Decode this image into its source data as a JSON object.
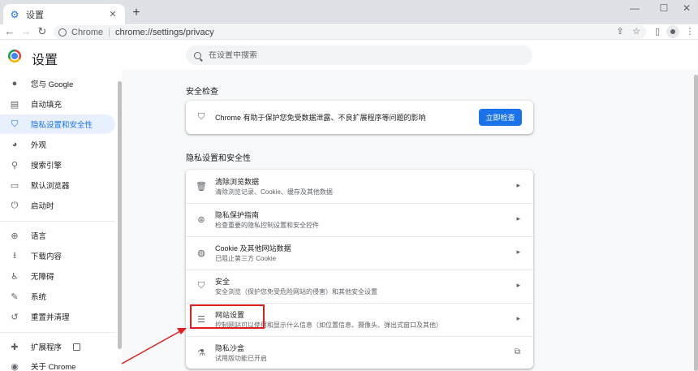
{
  "tab": {
    "title": "设置"
  },
  "address": {
    "site": "Chrome",
    "url": "chrome://settings/privacy"
  },
  "header": {
    "title": "设置",
    "search_placeholder": "在设置中搜索"
  },
  "sidebar": {
    "items": [
      {
        "label": "您与 Google",
        "icon": "person-icon"
      },
      {
        "label": "自动填充",
        "icon": "clipboard-icon"
      },
      {
        "label": "隐私设置和安全性",
        "icon": "shield-icon",
        "active": true
      },
      {
        "label": "外观",
        "icon": "palette-icon"
      },
      {
        "label": "搜索引擎",
        "icon": "search-icon"
      },
      {
        "label": "默认浏览器",
        "icon": "browser-icon"
      },
      {
        "label": "启动时",
        "icon": "power-icon"
      },
      {
        "label": "语言",
        "icon": "globe-icon"
      },
      {
        "label": "下载内容",
        "icon": "download-icon"
      },
      {
        "label": "无障碍",
        "icon": "accessibility-icon"
      },
      {
        "label": "系统",
        "icon": "wrench-icon"
      },
      {
        "label": "重置并清理",
        "icon": "reset-icon"
      },
      {
        "label": "扩展程序",
        "icon": "puzzle-icon"
      },
      {
        "label": "关于 Chrome",
        "icon": "chrome-icon"
      }
    ]
  },
  "safety_check": {
    "section_title": "安全检查",
    "description": "Chrome 有助于保护您免受数据泄露、不良扩展程序等问题的影响",
    "button_label": "立即检查"
  },
  "privacy": {
    "section_title": "隐私设置和安全性",
    "rows": [
      {
        "title": "清除浏览数据",
        "subtitle": "清除浏览记录、Cookie、缓存及其他数据",
        "icon": "trash-icon"
      },
      {
        "title": "隐私保护指南",
        "subtitle": "检查重要的隐私控制设置和安全控件",
        "icon": "privacy-guide-icon"
      },
      {
        "title": "Cookie 及其他网站数据",
        "subtitle": "已阻止第三方 Cookie",
        "icon": "cookie-icon"
      },
      {
        "title": "安全",
        "subtitle": "安全浏览（保护您免受危险网站的侵害）和其他安全设置",
        "icon": "security-shield-icon"
      },
      {
        "title": "网站设置",
        "subtitle": "控制网站可以使用和显示什么信息（如位置信息、摄像头、弹出式窗口及其他）",
        "icon": "sliders-icon"
      },
      {
        "title": "隐私沙盒",
        "subtitle": "试用版功能已开启",
        "icon": "flask-icon"
      }
    ]
  },
  "colors": {
    "accent": "#1a73e8",
    "annotation": "#e01e1e"
  }
}
